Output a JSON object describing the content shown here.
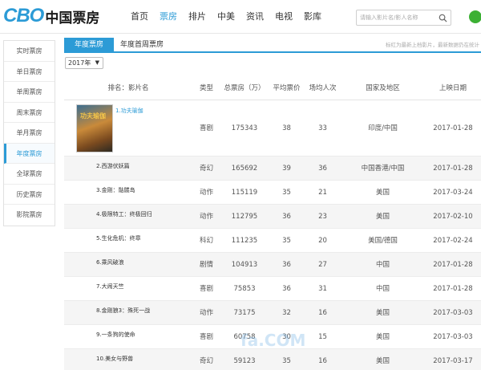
{
  "header": {
    "logo_latin": "CBO",
    "logo_cn": "中国票房",
    "nav": [
      "首页",
      "票房",
      "排片",
      "中美",
      "资讯",
      "电视",
      "影库"
    ],
    "search_placeholder": "请输入影片名/影人名称"
  },
  "sidebar": {
    "items": [
      "实时票房",
      "单日票房",
      "单周票房",
      "周末票房",
      "单月票房",
      "年度票房",
      "全球票房",
      "历史票房",
      "影院票房"
    ],
    "active_index": 5
  },
  "tabs": [
    "年度票房",
    "年度首周票房"
  ],
  "tab_note": "标红为最新上档影片，最新数据仍在统计",
  "year_select": "2017年",
  "table": {
    "headers": [
      "排名：影片名",
      "类型",
      "总票房（万）",
      "平均票价",
      "场均人次",
      "国家及地区",
      "上映日期"
    ],
    "rows": [
      {
        "title": "1.功夫瑜伽",
        "genre": "喜剧",
        "total": "175343",
        "avg_price": "38",
        "avg_people": "33",
        "region": "印度/中国",
        "date": "2017-01-28"
      },
      {
        "title": "2.西游伏妖篇",
        "genre": "奇幻",
        "total": "165692",
        "avg_price": "39",
        "avg_people": "36",
        "region": "中国香港/中国",
        "date": "2017-01-28"
      },
      {
        "title": "3.金刚：骷髅岛",
        "genre": "动作",
        "total": "115119",
        "avg_price": "35",
        "avg_people": "21",
        "region": "美国",
        "date": "2017-03-24"
      },
      {
        "title": "4.极限特工：终极回归",
        "genre": "动作",
        "total": "112795",
        "avg_price": "36",
        "avg_people": "23",
        "region": "美国",
        "date": "2017-02-10"
      },
      {
        "title": "5.生化危机：终章",
        "genre": "科幻",
        "total": "111235",
        "avg_price": "35",
        "avg_people": "20",
        "region": "美国/德国",
        "date": "2017-02-24"
      },
      {
        "title": "6.乘风破浪",
        "genre": "剧情",
        "total": "104913",
        "avg_price": "36",
        "avg_people": "27",
        "region": "中国",
        "date": "2017-01-28"
      },
      {
        "title": "7.大闹天竺",
        "genre": "喜剧",
        "total": "75853",
        "avg_price": "36",
        "avg_people": "31",
        "region": "中国",
        "date": "2017-01-28"
      },
      {
        "title": "8.金刚狼3：殊死一战",
        "genre": "动作",
        "total": "73175",
        "avg_price": "32",
        "avg_people": "16",
        "region": "美国",
        "date": "2017-03-03"
      },
      {
        "title": "9.一条狗的使命",
        "genre": "喜剧",
        "total": "60758",
        "avg_price": "30",
        "avg_people": "15",
        "region": "美国",
        "date": "2017-03-03"
      },
      {
        "title": "10.美女与野兽",
        "genre": "奇幻",
        "total": "59123",
        "avg_price": "35",
        "avg_people": "16",
        "region": "美国",
        "date": "2017-03-17"
      }
    ]
  },
  "poster_text": "功夫瑜伽",
  "watermark": "fa.COM"
}
